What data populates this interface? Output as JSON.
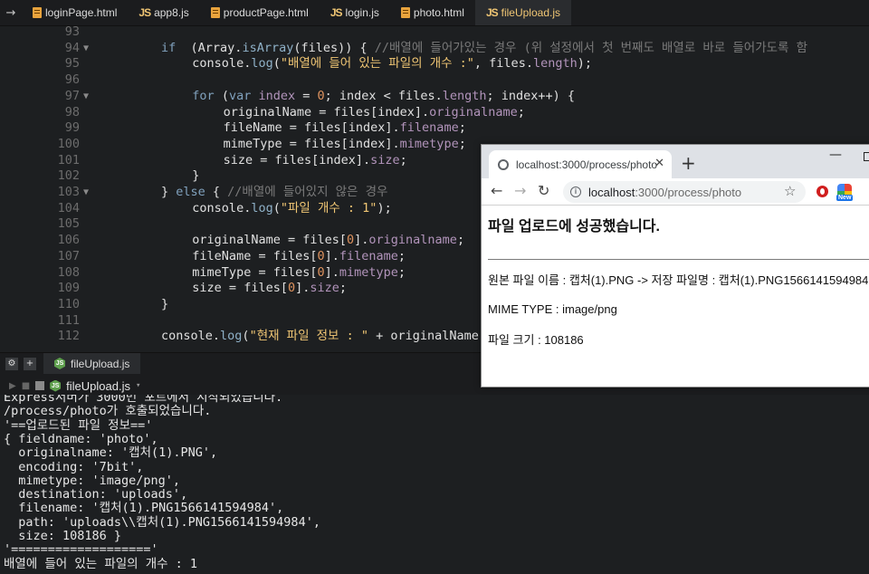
{
  "editor_tabs": [
    {
      "label": "loginPage.html",
      "type": "html",
      "active": false
    },
    {
      "label": "app8.js",
      "type": "js",
      "active": false
    },
    {
      "label": "productPage.html",
      "type": "html",
      "active": false
    },
    {
      "label": "login.js",
      "type": "js",
      "active": false
    },
    {
      "label": "photo.html",
      "type": "html",
      "active": false
    },
    {
      "label": "fileUpload.js",
      "type": "js",
      "active": true
    }
  ],
  "editor": {
    "lines": [
      {
        "n": "93",
        "fold": "",
        "indent": 0,
        "tokens": []
      },
      {
        "n": "94",
        "fold": "▼",
        "indent": 2,
        "tokens": [
          [
            "kw",
            "if"
          ],
          [
            "",
            "  ("
          ],
          [
            "",
            "Array."
          ],
          [
            "fn",
            "isArray"
          ],
          [
            "",
            "(files)) { "
          ],
          [
            "cmt",
            "//배열에 들어가있는 경우 (위 설정에서 첫 번째도 배열로 바로 들어가도록 함"
          ]
        ]
      },
      {
        "n": "95",
        "fold": "",
        "indent": 3,
        "tokens": [
          [
            "",
            "console."
          ],
          [
            "fn",
            "log"
          ],
          [
            "",
            "("
          ],
          [
            "str",
            "\"배열에 들어 있는 파일의 개수 :\""
          ],
          [
            "",
            ", files."
          ],
          [
            "prop",
            "length"
          ],
          [
            "",
            ");"
          ]
        ]
      },
      {
        "n": "96",
        "fold": "",
        "indent": 0,
        "tokens": []
      },
      {
        "n": "97",
        "fold": "▼",
        "indent": 3,
        "tokens": [
          [
            "kw",
            "for"
          ],
          [
            "",
            " ("
          ],
          [
            "kw",
            "var"
          ],
          [
            "",
            " "
          ],
          [
            "prop",
            "index"
          ],
          [
            "",
            " = "
          ],
          [
            "num",
            "0"
          ],
          [
            "",
            "; index < files."
          ],
          [
            "prop",
            "length"
          ],
          [
            "",
            "; index++) {"
          ]
        ]
      },
      {
        "n": "98",
        "fold": "",
        "indent": 4,
        "tokens": [
          [
            "",
            "originalName = files[index]."
          ],
          [
            "prop",
            "originalname"
          ],
          [
            "",
            ";"
          ]
        ]
      },
      {
        "n": "99",
        "fold": "",
        "indent": 4,
        "tokens": [
          [
            "",
            "fileName = files[index]."
          ],
          [
            "prop",
            "filename"
          ],
          [
            "",
            ";"
          ]
        ]
      },
      {
        "n": "100",
        "fold": "",
        "indent": 4,
        "tokens": [
          [
            "",
            "mimeType = files[index]."
          ],
          [
            "prop",
            "mimetype"
          ],
          [
            "",
            ";"
          ]
        ]
      },
      {
        "n": "101",
        "fold": "",
        "indent": 4,
        "tokens": [
          [
            "",
            "size = files[index]."
          ],
          [
            "prop",
            "size"
          ],
          [
            "",
            ";"
          ]
        ]
      },
      {
        "n": "102",
        "fold": "",
        "indent": 3,
        "tokens": [
          [
            "",
            "}"
          ]
        ]
      },
      {
        "n": "103",
        "fold": "▼",
        "indent": 2,
        "tokens": [
          [
            "",
            "} "
          ],
          [
            "kw",
            "else"
          ],
          [
            "",
            " { "
          ],
          [
            "cmt",
            "//배열에 들어있지 않은 경우"
          ]
        ]
      },
      {
        "n": "104",
        "fold": "",
        "indent": 3,
        "tokens": [
          [
            "",
            "console."
          ],
          [
            "fn",
            "log"
          ],
          [
            "",
            "("
          ],
          [
            "str",
            "\"파일 개수 : 1\""
          ],
          [
            "",
            ");"
          ]
        ]
      },
      {
        "n": "105",
        "fold": "",
        "indent": 0,
        "tokens": []
      },
      {
        "n": "106",
        "fold": "",
        "indent": 3,
        "tokens": [
          [
            "",
            "originalName = files["
          ],
          [
            "num",
            "0"
          ],
          [
            "",
            "]."
          ],
          [
            "prop",
            "originalname"
          ],
          [
            "",
            ";"
          ]
        ]
      },
      {
        "n": "107",
        "fold": "",
        "indent": 3,
        "tokens": [
          [
            "",
            "fileName = files["
          ],
          [
            "num",
            "0"
          ],
          [
            "",
            "]."
          ],
          [
            "prop",
            "filename"
          ],
          [
            "",
            ";"
          ]
        ]
      },
      {
        "n": "108",
        "fold": "",
        "indent": 3,
        "tokens": [
          [
            "",
            "mimeType = files["
          ],
          [
            "num",
            "0"
          ],
          [
            "",
            "]."
          ],
          [
            "prop",
            "mimetype"
          ],
          [
            "",
            ";"
          ]
        ]
      },
      {
        "n": "109",
        "fold": "",
        "indent": 3,
        "tokens": [
          [
            "",
            "size = files["
          ],
          [
            "num",
            "0"
          ],
          [
            "",
            "]."
          ],
          [
            "prop",
            "size"
          ],
          [
            "",
            ";"
          ]
        ]
      },
      {
        "n": "110",
        "fold": "",
        "indent": 2,
        "tokens": [
          [
            "",
            "}"
          ]
        ]
      },
      {
        "n": "111",
        "fold": "",
        "indent": 0,
        "tokens": []
      },
      {
        "n": "112",
        "fold": "",
        "indent": 2,
        "tokens": [
          [
            "",
            "console."
          ],
          [
            "fn",
            "log"
          ],
          [
            "",
            "("
          ],
          [
            "str",
            "\"현재 파일 정보 : \""
          ],
          [
            "",
            " + originalName"
          ]
        ]
      }
    ]
  },
  "panel": {
    "tab_label": "fileUpload.js",
    "run_title": "fileUpload.js"
  },
  "console_lines": [
    "Express서버가 3000번 포트에서 시작되었습니다.",
    "/process/photo가 호출되었습니다.",
    "'==업로드된 파일 정보=='",
    "{ fieldname: 'photo',",
    "  originalname: '캡처(1).PNG',",
    "  encoding: '7bit',",
    "  mimetype: 'image/png',",
    "  destination: 'uploads',",
    "  filename: '캡처(1).PNG1566141594984',",
    "  path: 'uploads\\\\캡처(1).PNG1566141594984',",
    "  size: 108186 }",
    "'==================='",
    "배열에 들어 있는 파일의 개수 : 1"
  ],
  "browser": {
    "tab_title": "localhost:3000/process/photo",
    "url_host": "localhost",
    "url_path": ":3000/process/photo",
    "new_badge": "New",
    "heading": "파일 업로드에 성공했습니다.",
    "line1": "원본 파일 이름 : 캡처(1).PNG -> 저장 파일명 : 캡처(1).PNG1566141594984",
    "line2": "MIME TYPE : image/png",
    "line3": "파일 크기 : 108186"
  },
  "icons": {
    "back_arrow": "arrow-right-icon",
    "html_file": "html5-icon",
    "js_file": "js-icon",
    "node_file": "nodejs-icon"
  }
}
